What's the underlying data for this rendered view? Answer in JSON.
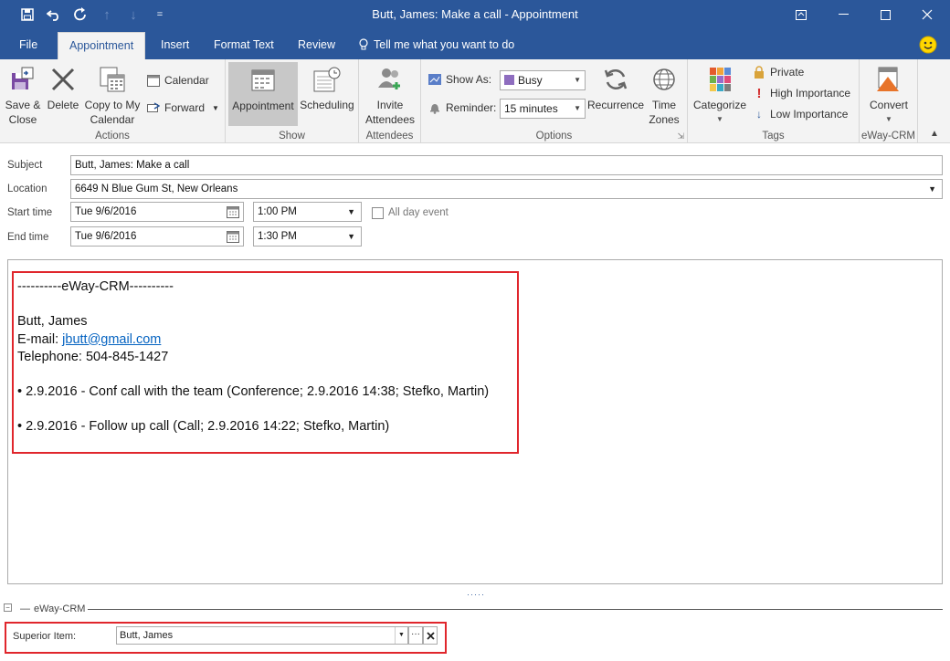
{
  "window": {
    "title": "Butt, James: Make a call  -  Appointment",
    "quick_access": [
      "save-icon",
      "undo-icon",
      "redo-icon",
      "up-icon",
      "down-icon",
      "customize-icon"
    ]
  },
  "tabs": [
    "File",
    "Appointment",
    "Insert",
    "Format Text",
    "Review"
  ],
  "tell_me": "Tell me what you want to do",
  "ribbon": {
    "actions": {
      "label": "Actions",
      "save_close": "Save &\nClose",
      "delete": "Delete",
      "copy_to_calendar": "Copy to My\nCalendar",
      "calendar": "Calendar",
      "forward": "Forward"
    },
    "show": {
      "label": "Show",
      "appointment": "Appointment",
      "scheduling": "Scheduling"
    },
    "attendees": {
      "label": "Attendees",
      "invite": "Invite\nAttendees"
    },
    "options": {
      "label": "Options",
      "show_as_label": "Show As:",
      "show_as_value": "Busy",
      "reminder_label": "Reminder:",
      "reminder_value": "15 minutes",
      "recurrence": "Recurrence",
      "time_zones": "Time\nZones"
    },
    "tags": {
      "label": "Tags",
      "categorize": "Categorize",
      "private": "Private",
      "high_importance": "High Importance",
      "low_importance": "Low Importance"
    },
    "eway": {
      "label": "eWay-CRM",
      "convert": "Convert"
    }
  },
  "form": {
    "subject_label": "Subject",
    "subject_value": "Butt, James: Make a call",
    "location_label": "Location",
    "location_value": "6649 N Blue Gum St, New Orleans",
    "start_label": "Start time",
    "start_date": "Tue 9/6/2016",
    "start_time": "1:00 PM",
    "end_label": "End time",
    "end_date": "Tue 9/6/2016",
    "end_time": "1:30 PM",
    "all_day_label": "All day event"
  },
  "body": {
    "header": "----------eWay-CRM----------",
    "name": "Butt, James",
    "email_label": "E-mail: ",
    "email": "jbutt@gmail.com",
    "telephone": "Telephone: 504-845-1427",
    "items": [
      "• 2.9.2016 - Conf call with the team (Conference; 2.9.2016 14:38; Stefko, Martin)",
      "• 2.9.2016 - Follow up call (Call; 2.9.2016 14:22; Stefko, Martin)"
    ]
  },
  "eway_panel": {
    "title": "eWay-CRM",
    "superior_label": "Superior Item:",
    "superior_value": "Butt, James"
  },
  "colors": {
    "accent": "#2b579a",
    "highlight": "#e0262c",
    "link": "#0563c1"
  }
}
